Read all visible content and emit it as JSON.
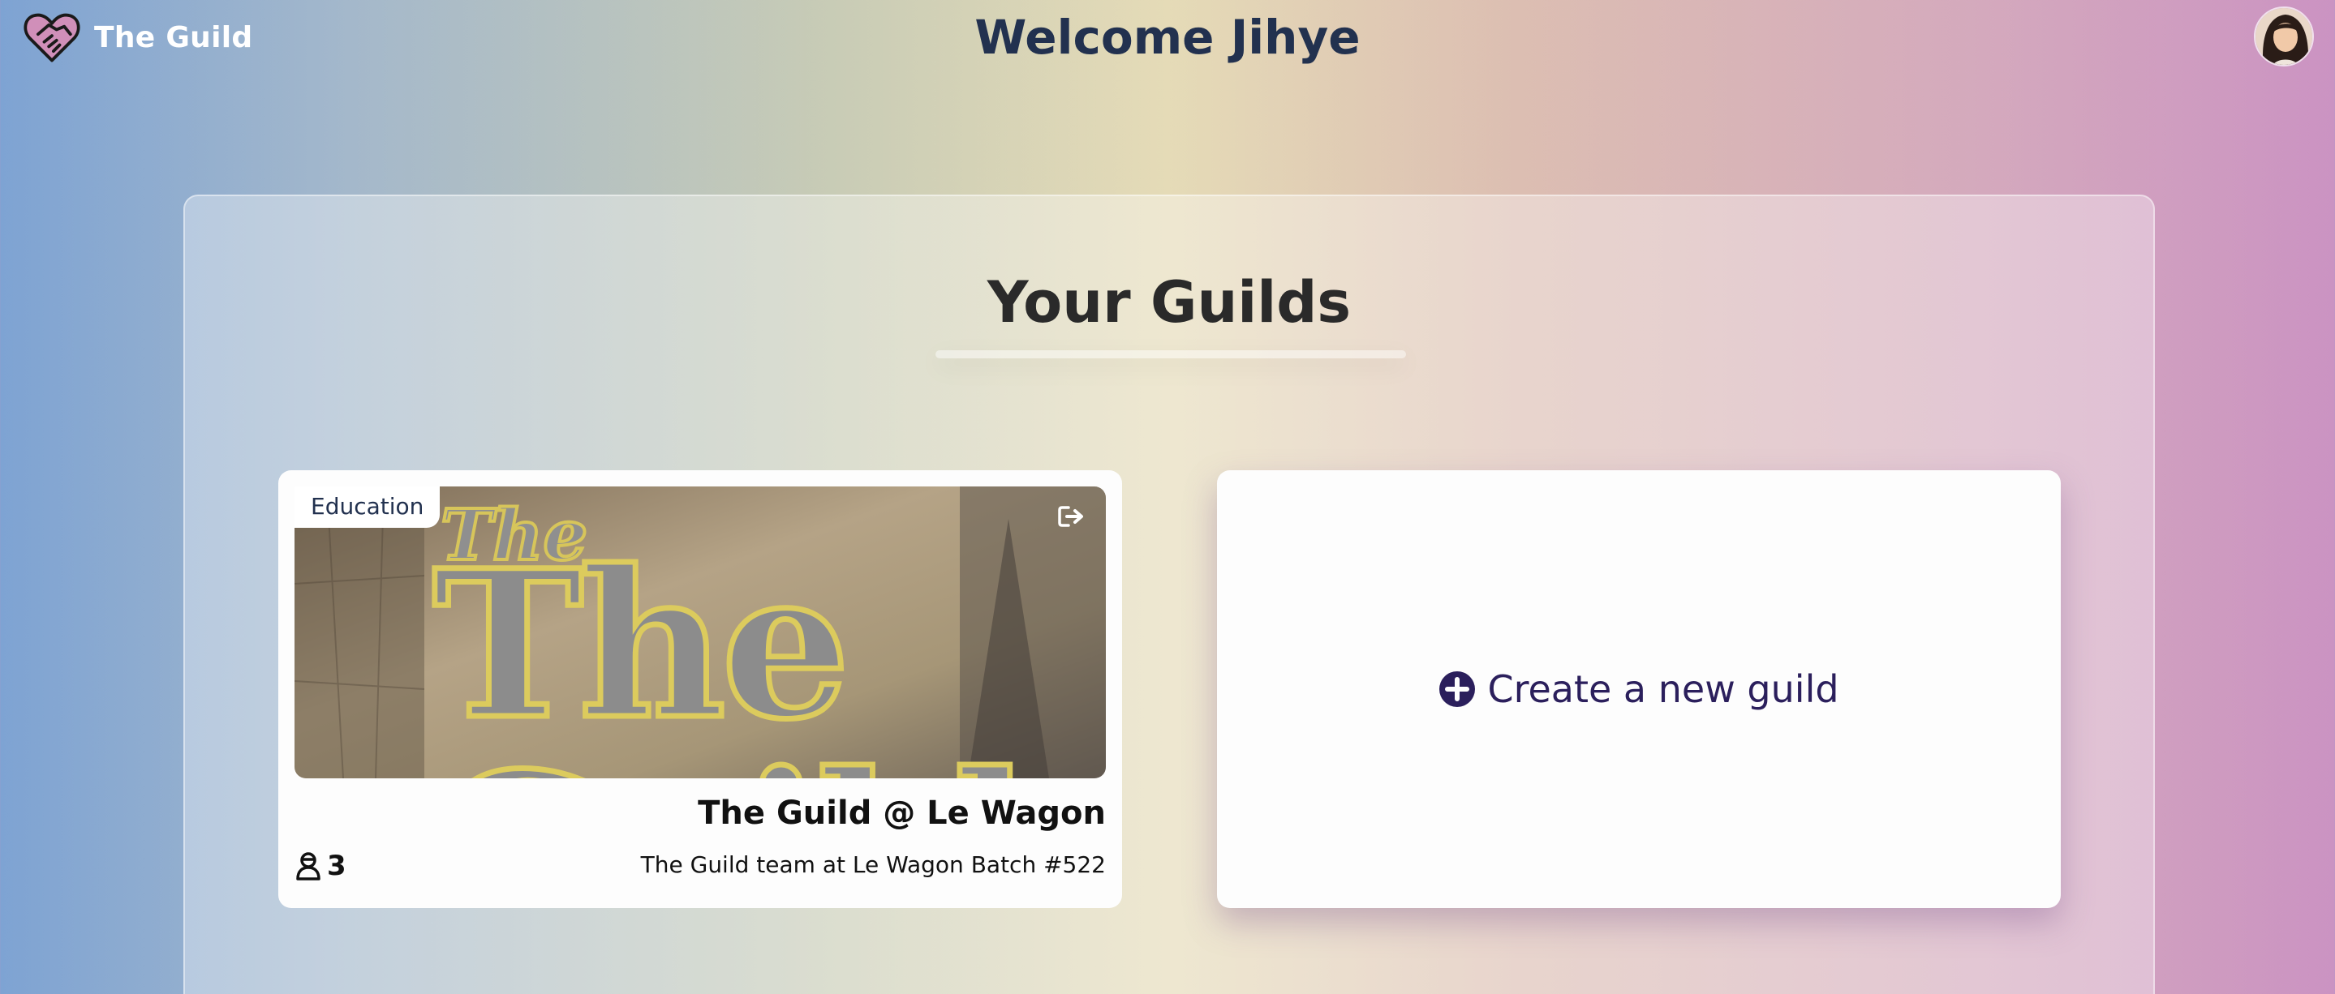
{
  "navbar": {
    "brand_name": "The Guild",
    "logo_icon": "heart-handshake-icon",
    "welcome": "Welcome Jihye",
    "avatar_icon": "user-avatar"
  },
  "main": {
    "title": "Your Guilds",
    "guilds": [
      {
        "category": "Education",
        "image_text": "The Guild",
        "name": "The Guild @ Le Wagon",
        "member_count": "3",
        "description": "The Guild team at Le Wagon Batch #522",
        "leave_icon": "leave-icon",
        "members_icon": "members-icon"
      }
    ],
    "create": {
      "label": "Create a new guild",
      "icon": "plus-circle-icon"
    }
  },
  "colors": {
    "heading": "#22314f",
    "accent": "#2b1f5c",
    "card": "#fdfdfd"
  }
}
